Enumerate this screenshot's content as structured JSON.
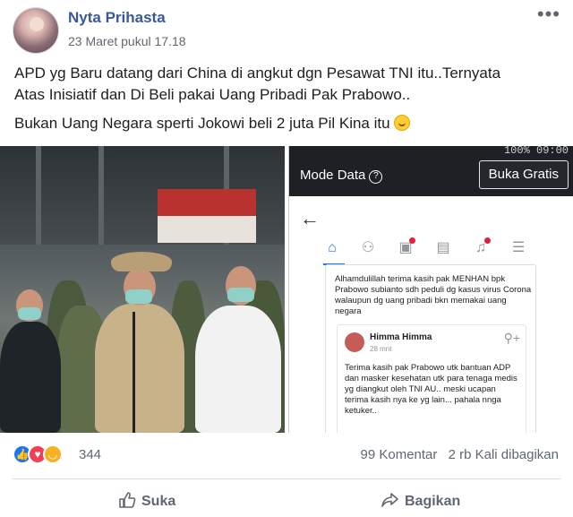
{
  "post": {
    "author": "Nyta Prihasta",
    "timestamp": "23 Maret pukul 17.18",
    "text_line1": "APD yg Baru datang dari China di angkut dgn Pesawat TNI itu..Ternyata",
    "text_line2": "Atas Inisiatif dan Di Beli pakai Uang Pribadi Pak Prabowo..",
    "text_line3": "Bukan Uang Negara sperti Jokowi beli 2 juta Pil Kina itu"
  },
  "screenshot": {
    "status_bar": "100% 09:00",
    "mode_data": "Mode Data",
    "buka_gratis": "Buka Gratis",
    "quoted_post_text": "Alhamdulillah terima kasih pak MENHAN bpk Prabowo subianto sdh peduli dg kasus virus Corona walaupun dg uang pribadi bkn memakai uang negara",
    "comment_name": "Himma Himma",
    "comment_time": "28 mnt",
    "comment_text": "Terima kasih pak Prabowo utk bantuan ADP dan masker kesehatan utk para tenaga medis yg diangkut oleh TNI AU.. meski ucapan terima kasih nya ke yg lain... pahala nnga ketuker.."
  },
  "engagement": {
    "reaction_count": "344",
    "comments": "99 Komentar",
    "shares": "2 rb Kali dibagikan"
  },
  "actions": {
    "like_label": "Suka",
    "share_label": "Bagikan"
  },
  "icons": {
    "like": "like-icon",
    "love": "love-icon",
    "haha": "haha-icon",
    "more": "more-options-icon",
    "share": "share-icon"
  },
  "colors": {
    "author_link": "#385898",
    "like_blue": "#1877f2",
    "love_red": "#f33e58",
    "haha_yellow": "#f7b125"
  }
}
